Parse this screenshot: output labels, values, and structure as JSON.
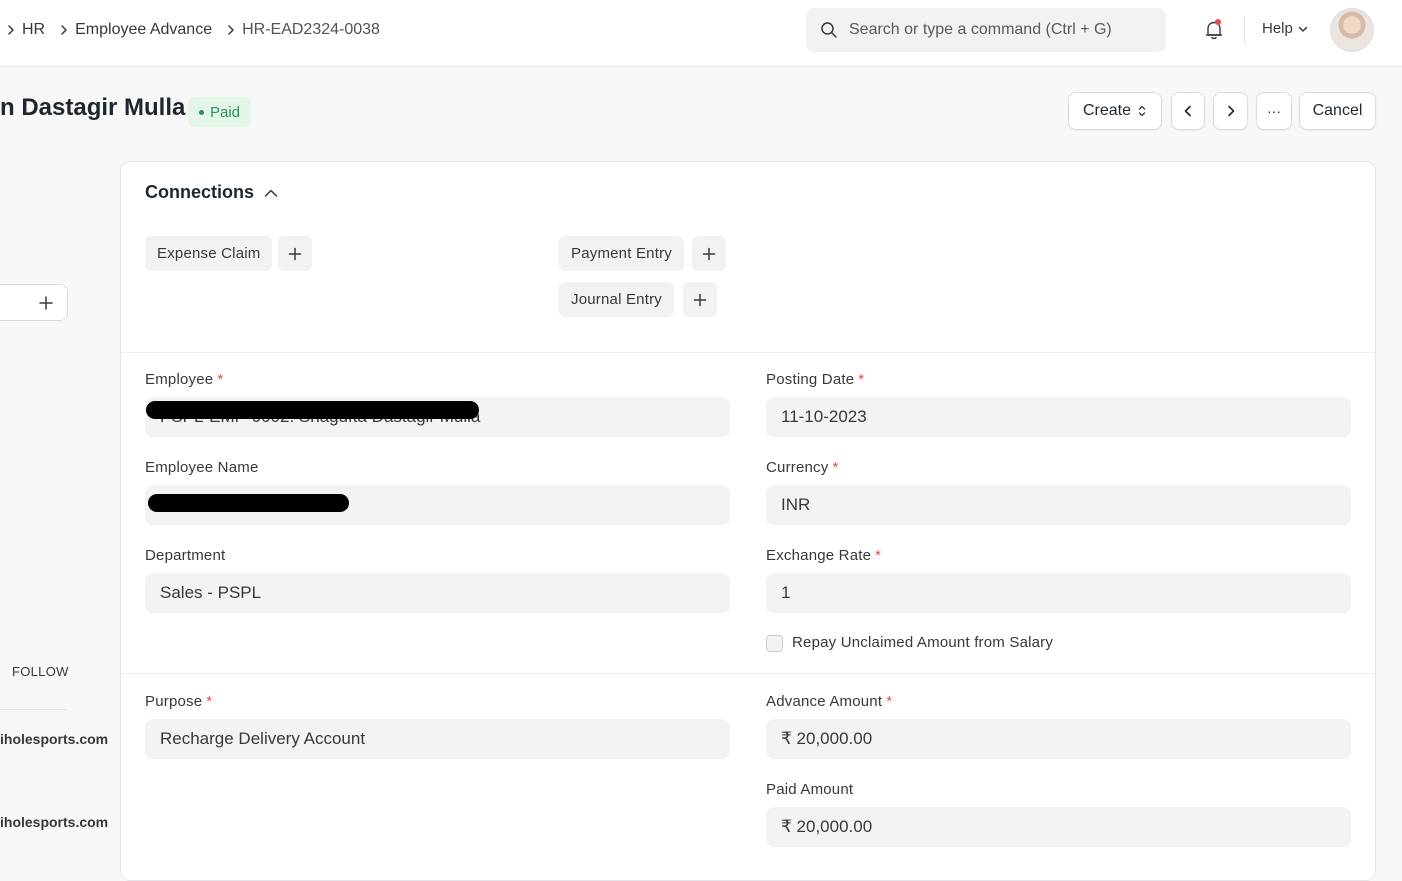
{
  "breadcrumbs": [
    "HR",
    "Employee Advance",
    "HR-EAD2324-0038"
  ],
  "search": {
    "placeholder": "Search or type a command (Ctrl + G)"
  },
  "navbar": {
    "help_label": "Help"
  },
  "page": {
    "title": "n Dastagir Mulla",
    "status": "Paid",
    "buttons": {
      "create": "Create",
      "more": "···",
      "cancel": "Cancel"
    }
  },
  "sidebar": {
    "follow_label": "FOLLOW",
    "links": [
      "iholesports.com",
      "iholesports.com"
    ]
  },
  "connections": {
    "title": "Connections",
    "items": [
      "Expense Claim",
      "Payment Entry",
      "Journal Entry"
    ]
  },
  "fields": {
    "employee": {
      "label": "Employee",
      "value": "PSPL-EMP-0002: Shagufta Dastagir Mulla"
    },
    "employee_name": {
      "label": "Employee Name",
      "value": ""
    },
    "department": {
      "label": "Department",
      "value": "Sales - PSPL"
    },
    "posting_date": {
      "label": "Posting Date",
      "value": "11-10-2023"
    },
    "currency": {
      "label": "Currency",
      "value": "INR"
    },
    "exchange_rate": {
      "label": "Exchange Rate",
      "value": "1"
    },
    "repay_label": "Repay Unclaimed Amount from Salary",
    "purpose": {
      "label": "Purpose",
      "value": "Recharge Delivery Account"
    },
    "advance_amount": {
      "label": "Advance Amount",
      "value": "₹ 20,000.00"
    },
    "paid_amount": {
      "label": "Paid Amount",
      "value": "₹ 20,000.00"
    }
  },
  "colors": {
    "accent_status_bg": "#e4f5e9",
    "accent_status_text": "#278f5e",
    "required": "#e24c4c"
  }
}
